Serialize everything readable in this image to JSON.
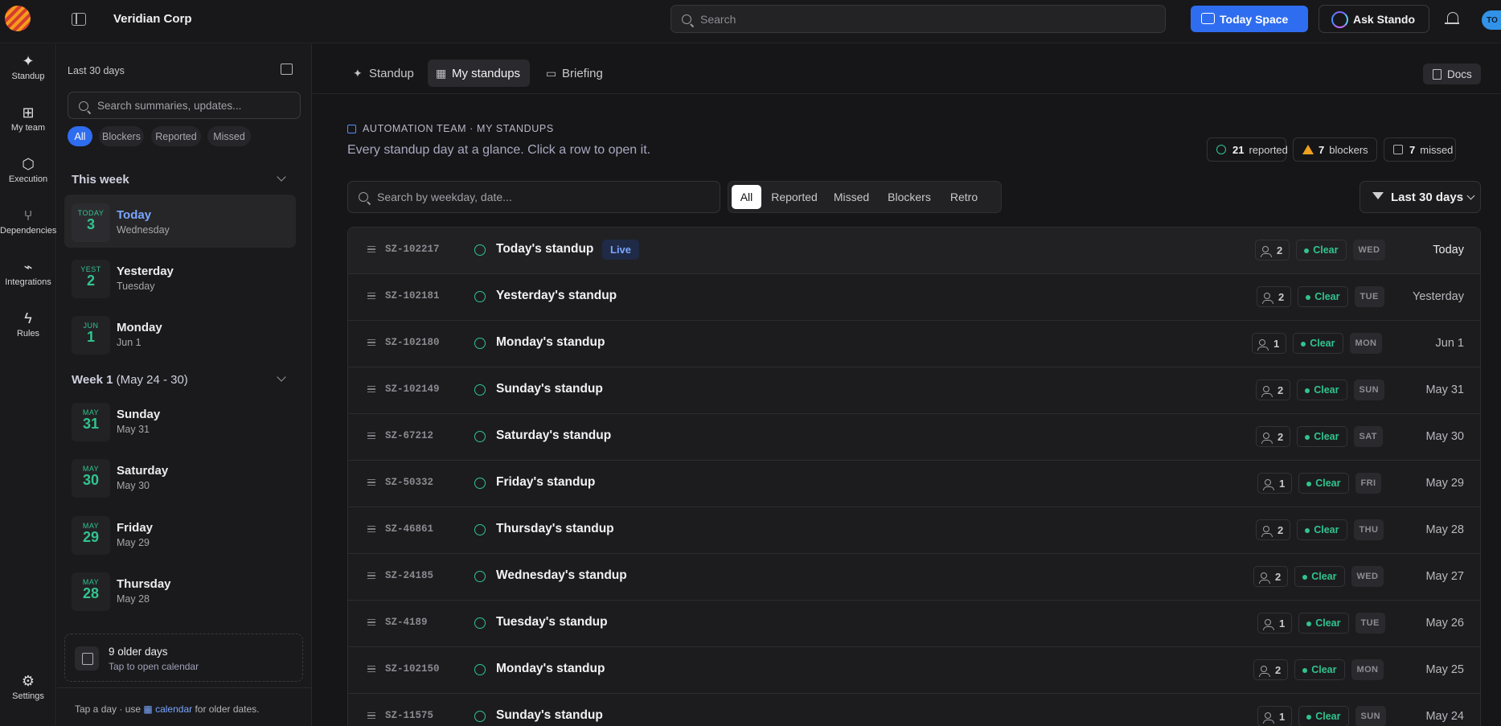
{
  "topbar": {
    "org_name": "Veridian Corp",
    "search_placeholder": "Search",
    "today_space_label": "Today Space",
    "ask_label": "Ask Stando",
    "avatar_initials": "TO"
  },
  "rail": {
    "items": [
      {
        "label": "Standup",
        "icon": "sparkle-icon"
      },
      {
        "label": "My team",
        "icon": "grid-icon"
      },
      {
        "label": "Execution",
        "icon": "hexagon-icon"
      },
      {
        "label": "Dependencies",
        "icon": "branch-icon"
      },
      {
        "label": "Integrations",
        "icon": "plug-icon"
      },
      {
        "label": "Rules",
        "icon": "bolt-icon"
      }
    ],
    "settings_label": "Settings"
  },
  "panel": {
    "range_label": "Last 30 days",
    "search_placeholder": "Search summaries, updates...",
    "chips": [
      "All",
      "Blockers",
      "Reported",
      "Missed"
    ],
    "this_week": {
      "title": "This week",
      "days": [
        {
          "badge_top": "TODAY",
          "badge_num": "3",
          "name": "Today",
          "sub": "Wednesday"
        },
        {
          "badge_top": "YEST",
          "badge_num": "2",
          "name": "Yesterday",
          "sub": "Tuesday"
        },
        {
          "badge_top": "JUN",
          "badge_num": "1",
          "name": "Monday",
          "sub": "Jun 1"
        }
      ]
    },
    "week1": {
      "title": "Week 1",
      "range": "(May 24 - 30)",
      "days": [
        {
          "badge_top": "MAY",
          "badge_num": "31",
          "name": "Sunday",
          "sub": "May 31"
        },
        {
          "badge_top": "MAY",
          "badge_num": "30",
          "name": "Saturday",
          "sub": "May 30"
        },
        {
          "badge_top": "MAY",
          "badge_num": "29",
          "name": "Friday",
          "sub": "May 29"
        },
        {
          "badge_top": "MAY",
          "badge_num": "28",
          "name": "Thursday",
          "sub": "May 28"
        }
      ]
    },
    "older": {
      "title": "9 older days",
      "sub": "Tap to open calendar"
    },
    "footer": {
      "prefix": "Tap a day · use",
      "link": "calendar",
      "suffix": "for older dates."
    }
  },
  "main": {
    "tabs": [
      "Standup",
      "My standups",
      "Briefing"
    ],
    "docs_label": "Docs",
    "crumb": "AUTOMATION TEAM · MY STANDUPS",
    "subtitle": "Every standup day at a glance. Click a row to open it.",
    "stats": [
      {
        "num": "21",
        "label": "reported"
      },
      {
        "num": "7",
        "label": "blockers"
      },
      {
        "num": "7",
        "label": "missed"
      }
    ],
    "list_search_placeholder": "Search by weekday, date...",
    "filters": [
      "All",
      "Reported",
      "Missed",
      "Blockers",
      "Retro"
    ],
    "range_button": "Last 30 days",
    "live_label": "Live",
    "rows": [
      {
        "id": "SZ-102217",
        "title": "Today's standup",
        "count": "2",
        "status": "Clear",
        "dow": "WED",
        "date": "Today"
      },
      {
        "id": "SZ-102181",
        "title": "Yesterday's standup",
        "count": "2",
        "status": "Clear",
        "dow": "TUE",
        "date": "Yesterday"
      },
      {
        "id": "SZ-102180",
        "title": "Monday's standup",
        "count": "1",
        "status": "Clear",
        "dow": "MON",
        "date": "Jun 1"
      },
      {
        "id": "SZ-102149",
        "title": "Sunday's standup",
        "count": "2",
        "status": "Clear",
        "dow": "SUN",
        "date": "May 31"
      },
      {
        "id": "SZ-67212",
        "title": "Saturday's standup",
        "count": "2",
        "status": "Clear",
        "dow": "SAT",
        "date": "May 30"
      },
      {
        "id": "SZ-50332",
        "title": "Friday's standup",
        "count": "1",
        "status": "Clear",
        "dow": "FRI",
        "date": "May 29"
      },
      {
        "id": "SZ-46861",
        "title": "Thursday's standup",
        "count": "2",
        "status": "Clear",
        "dow": "THU",
        "date": "May 28"
      },
      {
        "id": "SZ-24185",
        "title": "Wednesday's standup",
        "count": "2",
        "status": "Clear",
        "dow": "WED",
        "date": "May 27"
      },
      {
        "id": "SZ-4189",
        "title": "Tuesday's standup",
        "count": "1",
        "status": "Clear",
        "dow": "TUE",
        "date": "May 26"
      },
      {
        "id": "SZ-102150",
        "title": "Monday's standup",
        "count": "2",
        "status": "Clear",
        "dow": "MON",
        "date": "May 25"
      },
      {
        "id": "SZ-11575",
        "title": "Sunday's standup",
        "count": "1",
        "status": "Clear",
        "dow": "SUN",
        "date": "May 24"
      }
    ]
  },
  "colors": {
    "accent": "#2f6df0",
    "success": "#31c48d",
    "warning": "#f0a020",
    "background": "#161618"
  }
}
